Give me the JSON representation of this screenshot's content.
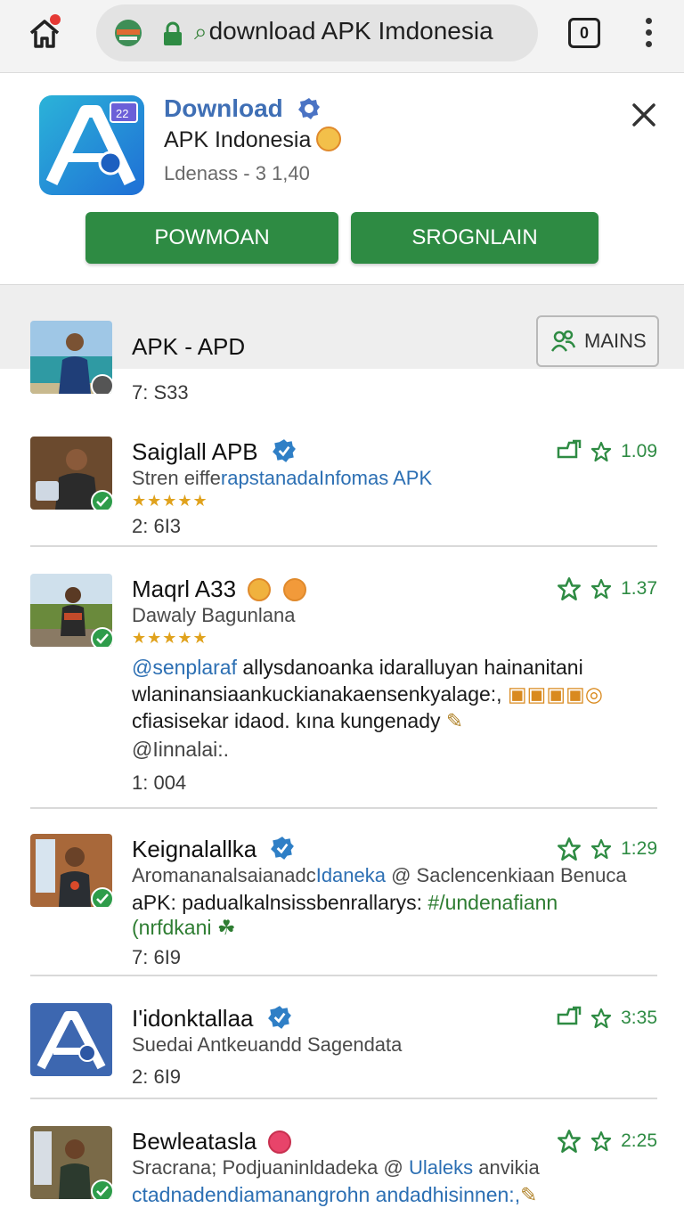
{
  "browser": {
    "url": "download APK Imdonesia",
    "tab_count": "0",
    "icons": {
      "home": "home-icon",
      "lock": "lock-icon",
      "menu": "more-vert-icon"
    }
  },
  "banner": {
    "title": "Download",
    "app_name": "APK Indonesia",
    "meta": "Ldenass - 3 1,40",
    "btn_primary": "POWMOAN",
    "btn_secondary": "SROGNLAIN"
  },
  "header_post": {
    "name": "APK - APD",
    "time": "7: S33",
    "mains_label": "MAINS"
  },
  "posts": [
    {
      "name": "Saiglall APB",
      "sub_plain": "Stren eiffe",
      "sub_link": "rapstanadaInfomas APK",
      "stars": "★★★★★",
      "time": "2: 6I3",
      "count": "1.09"
    },
    {
      "name": "Maqrl A33",
      "sub_plain": "Dawaly Bagunlana",
      "stars": "★★★★★",
      "body1_link": "@senplaraf",
      "body1_text": " allysdanoanka idaralluyan hainanitani",
      "body2": "wlaninansiaankuckianakaensenkyalage:,",
      "body3": "cfiasisekar idaod. kına kungenady",
      "body4": "@Iinnalai:.",
      "time": "1: 004",
      "count": "1.37"
    },
    {
      "name": "Keignalallka",
      "sub_plain": "Aromananalsaianadc",
      "sub_link": "Idaneka",
      "sub_tail": " @ Saclencenkiaan Benuca",
      "body2_plain": "aPK: padualkalnsissbenrallarys: ",
      "body2_link": "#/undenafiann",
      "body3": "(nrfdkani",
      "time": "7: 6I9",
      "count": "1:29"
    },
    {
      "name": "I'idonktallaa",
      "sub_plain": "Suedai Antkeuandd Sagendata",
      "time": "2: 6I9",
      "count": "3:35"
    },
    {
      "name": "Bewleatasla",
      "sub_plain": "Sracrana; Podjuaninldadeka @ ",
      "sub_link": "Ulaleks",
      "sub_tail": " anvikia",
      "body2": "ctadnadendiamanangrohn andadhisinnen:,",
      "count": "2:25"
    }
  ],
  "colors": {
    "accent_green": "#2e8b43",
    "link_blue": "#2c6fb3",
    "title_blue": "#3f6fb5"
  }
}
